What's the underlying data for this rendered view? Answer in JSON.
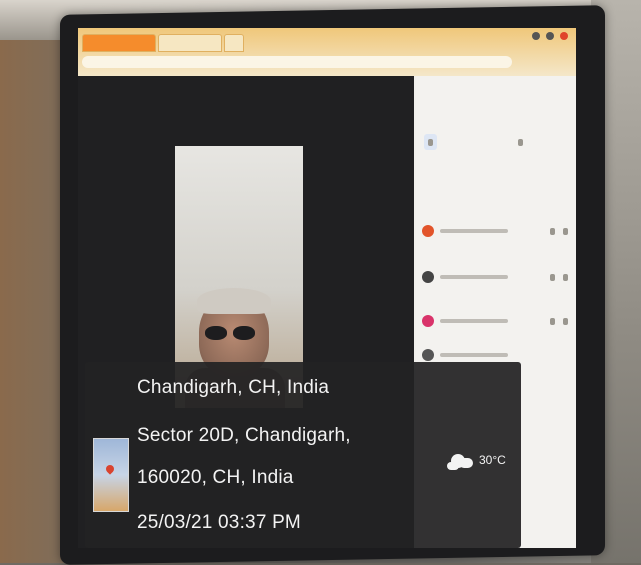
{
  "overlay": {
    "location_title": "Chandigarh, CH, India",
    "address_line1": "Sector 20D, Chandigarh,",
    "address_line2": "160020, CH, India",
    "datetime": "25/03/21 03:37 PM",
    "temperature": "30°C",
    "weather_icon": "partly-cloudy-icon",
    "map_icon": "map-thumbnail-icon"
  },
  "colors": {
    "overlay_bg": "#222224",
    "overlay_text": "#f3f3f3",
    "browser_tab_accent": "#f58c2c",
    "screen_panel_bg": "#f3f2ef"
  }
}
